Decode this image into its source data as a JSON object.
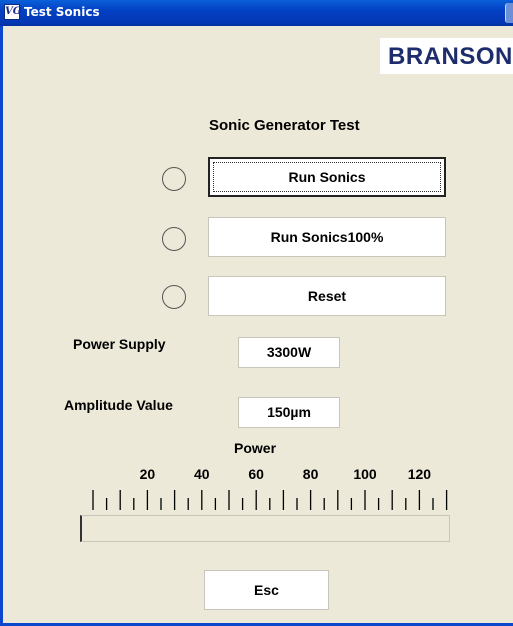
{
  "window": {
    "title": "Test Sonics",
    "icon": "VG"
  },
  "brand": {
    "text": "BRANSON"
  },
  "heading": "Sonic Generator Test",
  "buttons": [
    {
      "label": "Run Sonics",
      "focused": true
    },
    {
      "label": "Run Sonics100%"
    },
    {
      "label": "Reset"
    }
  ],
  "power_supply": {
    "label": "Power Supply",
    "value": "3300W"
  },
  "amplitude": {
    "label": "Amplitude Value",
    "value": "150µm"
  },
  "gauge": {
    "title": "Power",
    "scale_labels": [
      "20",
      "40",
      "60",
      "80",
      "100",
      "120"
    ],
    "scale_min": 0,
    "scale_max": 130,
    "level_percent": 0
  },
  "esc_label": "Esc",
  "colors": {
    "titlebar": "#0340c4",
    "window_bg": "#ece9d8",
    "brand_text": "#1d2c6c"
  }
}
